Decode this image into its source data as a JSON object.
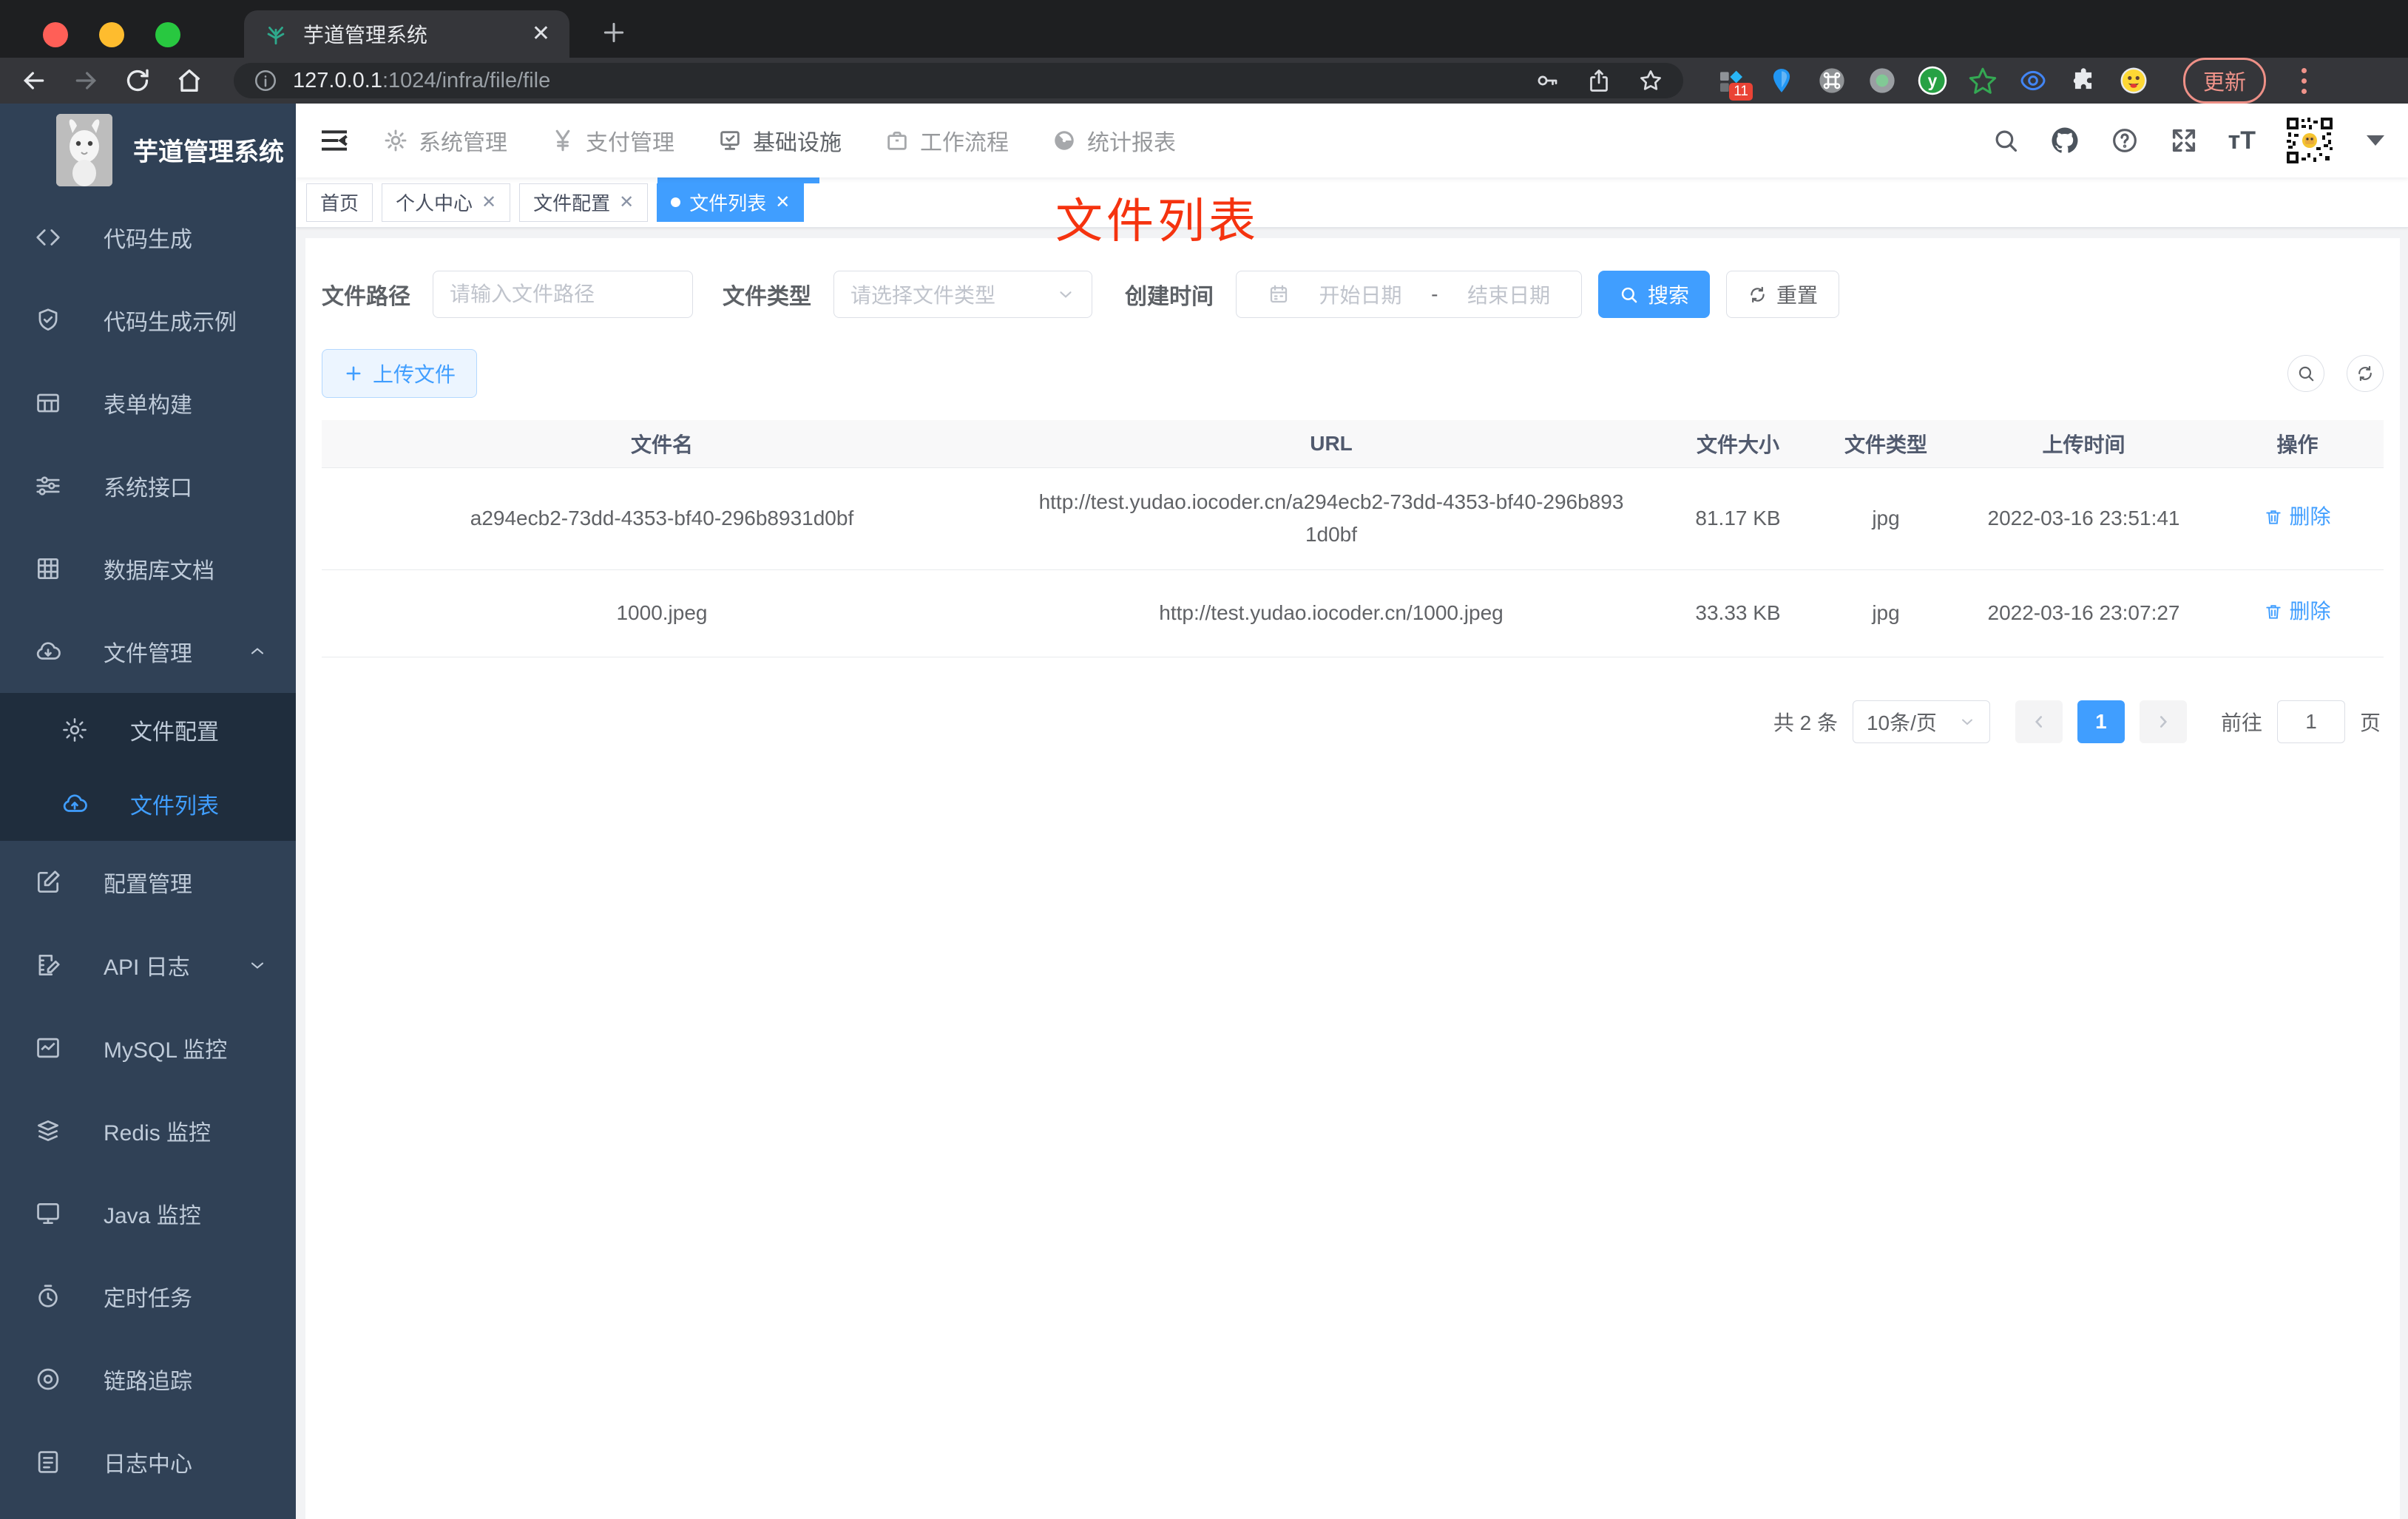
{
  "browser": {
    "tab": {
      "title": "芋道管理系统",
      "close": "✕",
      "new_tab": "+"
    },
    "url": {
      "host": "127.0.0.1",
      "rest": ":1024/infra/file/file"
    },
    "extensions_badge": "11",
    "extension_y_label": "y",
    "update_label": "更新"
  },
  "sidebar": {
    "title": "芋道管理系统",
    "items": [
      {
        "label": "代码生成",
        "icon": "code-icon"
      },
      {
        "label": "代码生成示例",
        "icon": "shield-check-icon"
      },
      {
        "label": "表单构建",
        "icon": "form-table-icon"
      },
      {
        "label": "系统接口",
        "icon": "sliders-icon"
      },
      {
        "label": "数据库文档",
        "icon": "grid-icon"
      },
      {
        "label": "文件管理",
        "icon": "cloud-download-icon",
        "expanded": true,
        "children": [
          {
            "label": "文件配置",
            "icon": "gear-icon"
          },
          {
            "label": "文件列表",
            "icon": "cloud-upload-icon",
            "active": true
          }
        ]
      },
      {
        "label": "配置管理",
        "icon": "edit-square-icon"
      },
      {
        "label": "API 日志",
        "icon": "document-edit-icon",
        "collapsed": true
      },
      {
        "label": "MySQL 监控",
        "icon": "chart-monitor-icon"
      },
      {
        "label": "Redis 监控",
        "icon": "layers-icon"
      },
      {
        "label": "Java 监控",
        "icon": "monitor-icon"
      },
      {
        "label": "定时任务",
        "icon": "timer-icon"
      },
      {
        "label": "链路追踪",
        "icon": "trace-icon"
      },
      {
        "label": "日志中心",
        "icon": "log-file-icon"
      }
    ]
  },
  "topnav": {
    "items": [
      {
        "label": "系统管理",
        "icon": "gear-icon"
      },
      {
        "label": "支付管理",
        "icon": "yen-icon"
      },
      {
        "label": "基础设施",
        "icon": "infra-monitor-icon",
        "active": true
      },
      {
        "label": "工作流程",
        "icon": "briefcase-icon"
      },
      {
        "label": "统计报表",
        "icon": "dashboard-icon"
      }
    ]
  },
  "tags": {
    "items": [
      {
        "label": "首页",
        "closable": false,
        "active": false
      },
      {
        "label": "个人中心",
        "closable": true,
        "active": false
      },
      {
        "label": "文件配置",
        "closable": true,
        "active": false
      },
      {
        "label": "文件列表",
        "closable": true,
        "active": true
      }
    ],
    "close_glyph": "✕"
  },
  "overlay_title": "文件列表",
  "filters": {
    "path_label": "文件路径",
    "path_placeholder": "请输入文件路径",
    "type_label": "文件类型",
    "type_placeholder": "请选择文件类型",
    "date_label": "创建时间",
    "date_start": "开始日期",
    "date_sep": "-",
    "date_end": "结束日期",
    "search_label": "搜索",
    "reset_label": "重置"
  },
  "toolbar": {
    "upload_label": "上传文件"
  },
  "table": {
    "headers": [
      "文件名",
      "URL",
      "文件大小",
      "文件类型",
      "上传时间",
      "操作"
    ],
    "rows": [
      {
        "name": "a294ecb2-73dd-4353-bf40-296b8931d0bf",
        "url": "http://test.yudao.iocoder.cn/a294ecb2-73dd-4353-bf40-296b8931d0bf",
        "size": "81.17 KB",
        "type": "jpg",
        "time": "2022-03-16 23:51:41",
        "action": "删除"
      },
      {
        "name": "1000.jpeg",
        "url": "http://test.yudao.iocoder.cn/1000.jpeg",
        "size": "33.33 KB",
        "type": "jpg",
        "time": "2022-03-16 23:07:27",
        "action": "删除"
      }
    ]
  },
  "pagination": {
    "total": "共 2 条",
    "page_size": "10条/页",
    "current": "1",
    "goto_label": "前往",
    "goto_value": "1",
    "page_label": "页"
  },
  "colors": {
    "primary": "#409eff",
    "sidebar_bg": "#304156",
    "submenu_bg": "#1f2d3d",
    "sidebar_text": "#bfcbd9",
    "overlay_red": "#f5330f"
  }
}
